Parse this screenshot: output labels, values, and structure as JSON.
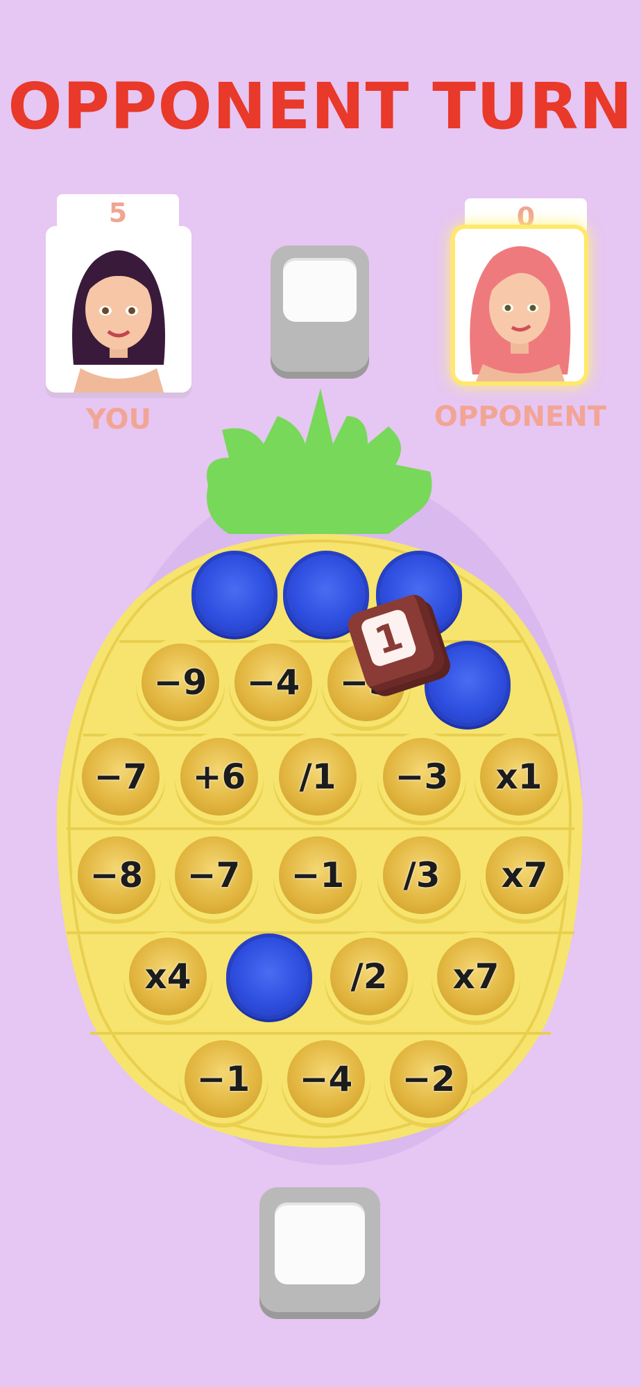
{
  "header": {
    "title": "OPPONENT TURN"
  },
  "players": [
    {
      "id": "you",
      "name": "YOU",
      "score": "5",
      "active": false
    },
    {
      "id": "opponent",
      "name": "OPPONENT",
      "score": "0",
      "active": true
    }
  ],
  "board": {
    "shape": "pineapple",
    "rows": [
      [
        {
          "label": "",
          "pressed": true
        },
        {
          "label": "",
          "pressed": true
        },
        {
          "label": "",
          "pressed": true
        }
      ],
      [
        {
          "label": "−9",
          "pressed": false
        },
        {
          "label": "−4",
          "pressed": false
        },
        {
          "label": "−5",
          "pressed": false
        },
        {
          "label": "",
          "pressed": true
        }
      ],
      [
        {
          "label": "−7",
          "pressed": false
        },
        {
          "label": "+6",
          "pressed": false
        },
        {
          "label": "/1",
          "pressed": false
        },
        {
          "label": "−3",
          "pressed": false
        },
        {
          "label": "x1",
          "pressed": false
        }
      ],
      [
        {
          "label": "−8",
          "pressed": false
        },
        {
          "label": "−7",
          "pressed": false
        },
        {
          "label": "−1",
          "pressed": false
        },
        {
          "label": "/3",
          "pressed": false
        },
        {
          "label": "x7",
          "pressed": false
        }
      ],
      [
        {
          "label": "x4",
          "pressed": false
        },
        {
          "label": "",
          "pressed": true
        },
        {
          "label": "/2",
          "pressed": false
        },
        {
          "label": "x7",
          "pressed": false
        }
      ],
      [
        {
          "label": "−1",
          "pressed": false
        },
        {
          "label": "−4",
          "pressed": false
        },
        {
          "label": "−2",
          "pressed": false
        }
      ]
    ]
  },
  "die": {
    "value": "1"
  },
  "colors": {
    "background": "#e6c6f2",
    "title": "#e8392a",
    "board": "#f6e46e",
    "leaves": "#77d85a",
    "pressed_pop": "#2f4fe0"
  }
}
